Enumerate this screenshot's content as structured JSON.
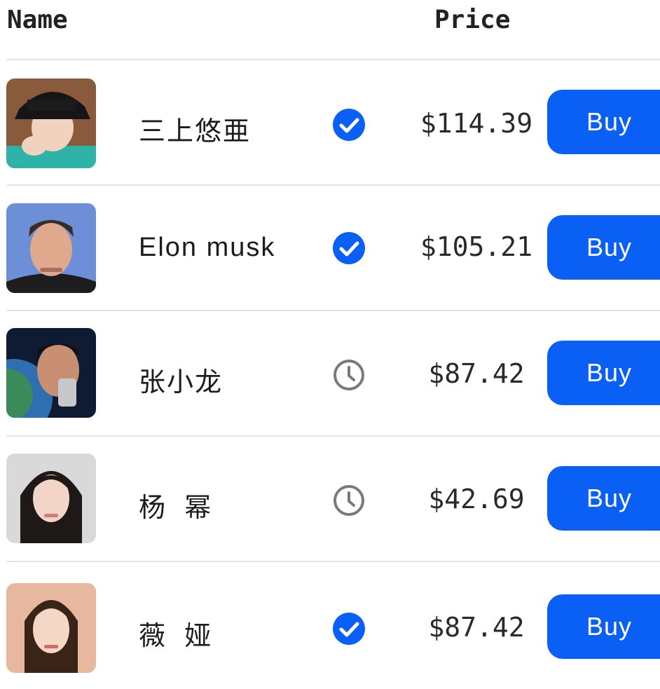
{
  "header": {
    "name_label": "Name",
    "price_label": "Price"
  },
  "colors": {
    "accent": "#0a5ff5",
    "pending": "#7a7a7a",
    "divider": "#e3e3e3"
  },
  "rows": [
    {
      "name": "三上悠亜",
      "status": "verified",
      "status_icon": "check-circle-icon",
      "price": "$114.39",
      "buy_label": "Buy"
    },
    {
      "name": "Elon musk",
      "status": "verified",
      "status_icon": "check-circle-icon",
      "price": "$105.21",
      "buy_label": "Buy"
    },
    {
      "name": "张小龙",
      "status": "pending",
      "status_icon": "clock-icon",
      "price": "$87.42",
      "buy_label": "Buy"
    },
    {
      "name": "杨  幂",
      "status": "pending",
      "status_icon": "clock-icon",
      "price": "$42.69",
      "buy_label": "Buy"
    },
    {
      "name": "薇  娅",
      "status": "verified",
      "status_icon": "check-circle-icon",
      "price": "$87.42",
      "buy_label": "Buy"
    }
  ]
}
